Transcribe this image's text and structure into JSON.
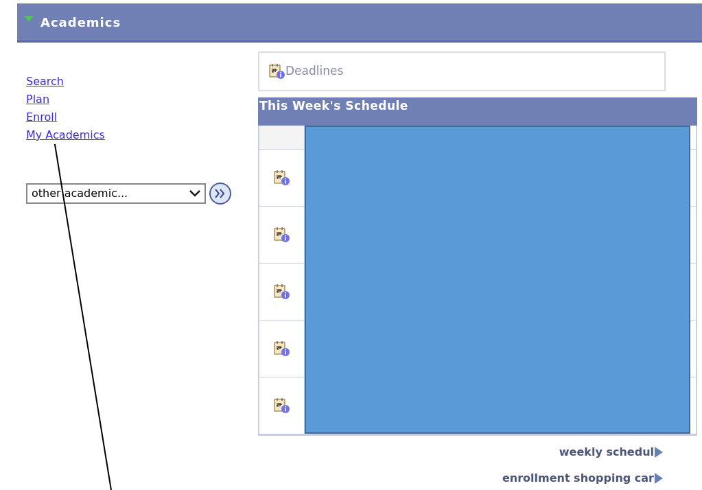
{
  "section": {
    "title": "Academics",
    "expanded": true
  },
  "links": [
    {
      "label": "Search"
    },
    {
      "label": "Plan"
    },
    {
      "label": "Enroll"
    },
    {
      "label": "My Academics"
    }
  ],
  "dropdown": {
    "value": "other academic..."
  },
  "deadlines": {
    "label": "Deadlines"
  },
  "schedule": {
    "title": "This Week's Schedule",
    "rows": [
      {
        "kind": "blank"
      },
      {
        "kind": "info"
      },
      {
        "kind": "info"
      },
      {
        "kind": "info"
      },
      {
        "kind": "info"
      },
      {
        "kind": "info"
      }
    ]
  },
  "footer_links": [
    {
      "label": "weekly schedul"
    },
    {
      "label": "enrollment shopping car"
    }
  ]
}
